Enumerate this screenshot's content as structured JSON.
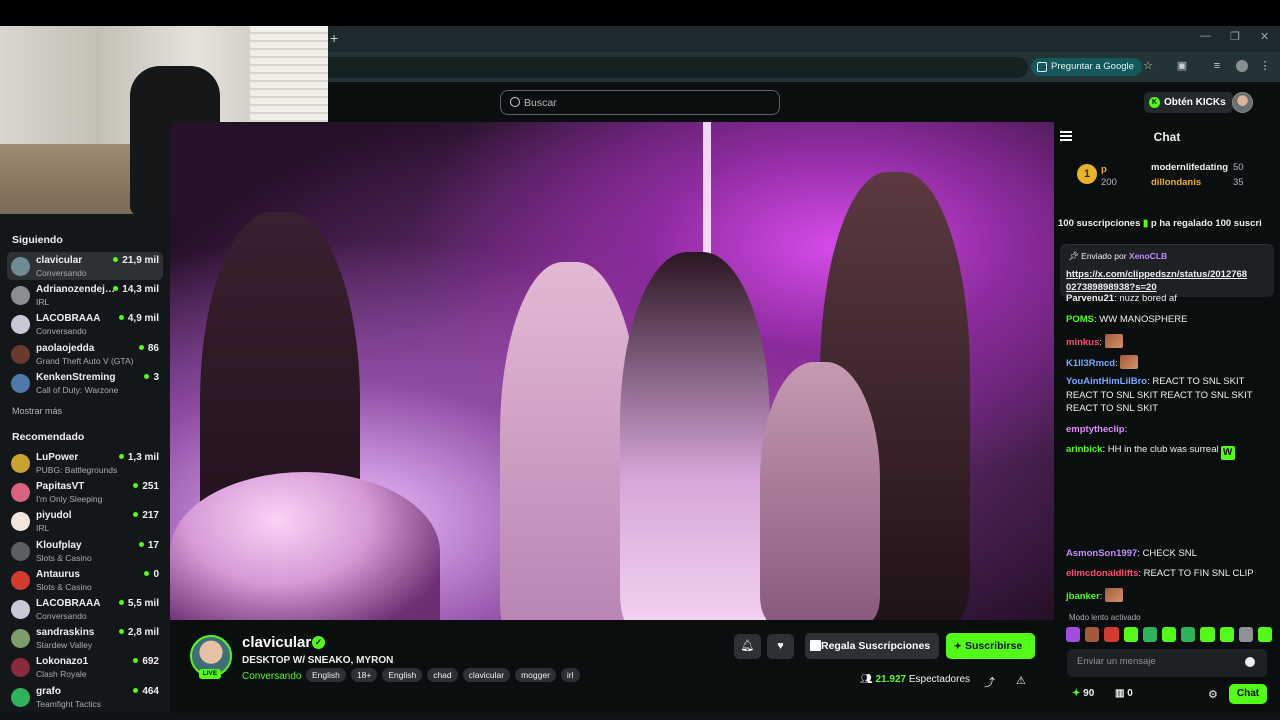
{
  "browser": {
    "new_tab": "+",
    "ask_google": "Preguntar a Google"
  },
  "header": {
    "search_placeholder": "Buscar",
    "kicks_button": "Obtén KICKs",
    "kicks_icon_letter": "K"
  },
  "sidebar": {
    "following_title": "Siguiendo",
    "show_more": "Mostrar más",
    "recommended_title": "Recomendado",
    "following": [
      {
        "name": "clavicular",
        "category": "Conversando",
        "viewers": "21,9 mil",
        "color": "#6f8b93"
      },
      {
        "name": "Adrianozendejas",
        "category": "IRL",
        "viewers": "14,3 mil",
        "color": "#8a8f92"
      },
      {
        "name": "LACOBRAAA",
        "category": "Conversando",
        "viewers": "4,9 mil",
        "color": "#c7c9d9"
      },
      {
        "name": "paolaojedda",
        "category": "Grand Theft Auto V (GTA)",
        "viewers": "86",
        "color": "#6a3b2c"
      },
      {
        "name": "KenkenStreming",
        "category": "Call of Duty: Warzone",
        "viewers": "3",
        "color": "#4d7aa8"
      }
    ],
    "recommended": [
      {
        "name": "LuPower",
        "category": "PUBG: Battlegrounds",
        "viewers": "1,3 mil",
        "color": "#c9a330"
      },
      {
        "name": "PapitasVT",
        "category": "I'm Only Sleeping",
        "viewers": "251",
        "color": "#d9627e"
      },
      {
        "name": "piyudol",
        "category": "IRL",
        "viewers": "217",
        "color": "#f2e6dc"
      },
      {
        "name": "Kloufplay",
        "category": "Slots & Casino",
        "viewers": "17",
        "color": "#5a5f63"
      },
      {
        "name": "Antaurus",
        "category": "Slots & Casino",
        "viewers": "0",
        "color": "#d23b2f"
      },
      {
        "name": "LACOBRAAA",
        "category": "Conversando",
        "viewers": "5,5 mil",
        "color": "#c7c9d9"
      },
      {
        "name": "sandraskins",
        "category": "Stardew Valley",
        "viewers": "2,8 mil",
        "color": "#7c9e6a"
      },
      {
        "name": "Lokonazo1",
        "category": "Clash Royale",
        "viewers": "692",
        "color": "#8a2a3a"
      },
      {
        "name": "grafo",
        "category": "Teamfight Tactics",
        "viewers": "464",
        "color": "#2fb35a"
      }
    ]
  },
  "stream": {
    "streamer": "clavicular",
    "live_badge": "LIVE",
    "title": "DESKTOP W/ SNEAKO, MYRON",
    "category": "Conversando",
    "tags": [
      "English",
      "18+",
      "English",
      "chad",
      "clavicular",
      "mogger",
      "irl"
    ],
    "gift_button": "Regala Suscripciones",
    "subscribe_button": "Suscribirse",
    "viewer_count": "21.927",
    "viewer_label": "Espectadores"
  },
  "chat": {
    "title": "Chat",
    "leaderboard": {
      "top_rank": "1",
      "top_user": "p",
      "top_value": "200",
      "second": {
        "user": "modernlifedating",
        "value": "50"
      },
      "third": {
        "user": "dillondanis",
        "value": "35"
      }
    },
    "gift_banner_a": "100 suscripciones",
    "gift_banner_b": "p ha regalado 100 suscri",
    "pinned": {
      "by_label": "Enviado por",
      "by_user": "XenoCLB",
      "link": "https://x.com/clippedszn/status/2012768027389898938?s=20"
    },
    "messages": [
      {
        "user": "Parvenu21",
        "text": "nuzz bored af",
        "color": "#efeff1"
      },
      {
        "user": "POMS",
        "text": "WW MANOSPHERE",
        "color": "#53fc18"
      },
      {
        "user": "minkus",
        "text": "",
        "color": "#ff4d6d",
        "emote": true
      },
      {
        "user": "K1ll3Rmcd",
        "text": "",
        "color": "#7aa7ff",
        "emote": true
      },
      {
        "user": "YouAintHimLilBro",
        "text": "REACT TO SNL SKIT REACT TO SNL SKIT REACT TO SNL SKIT REACT TO SNL SKIT",
        "color": "#7aa7ff"
      },
      {
        "user": "emptytheclip",
        "text": "",
        "color": "#e08cff"
      },
      {
        "user": "arinbick",
        "text": "HH in the club was surreal",
        "color": "#53fc18"
      },
      {
        "user": "AsmonSon1997",
        "text": "CHECK SNL",
        "color": "#c38cff"
      },
      {
        "user": "elimcdonaldlifts",
        "text": "REACT TO FIN SNL CLIP",
        "color": "#ff4d6d"
      },
      {
        "user": "jbanker",
        "text": "",
        "color": "#53fc18",
        "emote": true
      }
    ],
    "slow_mode": "Modo lento activado",
    "input_placeholder": "Enviar un mensaje",
    "points_a": "90",
    "points_b": "0",
    "chat_button": "Chat",
    "emote_colors": [
      "#a34de0",
      "#a45a3c",
      "#d23b2f",
      "#53fc18",
      "#2fb35a",
      "#53fc18",
      "#2fb35a",
      "#53fc18",
      "#53fc18",
      "#8d9294",
      "#53fc18"
    ]
  }
}
